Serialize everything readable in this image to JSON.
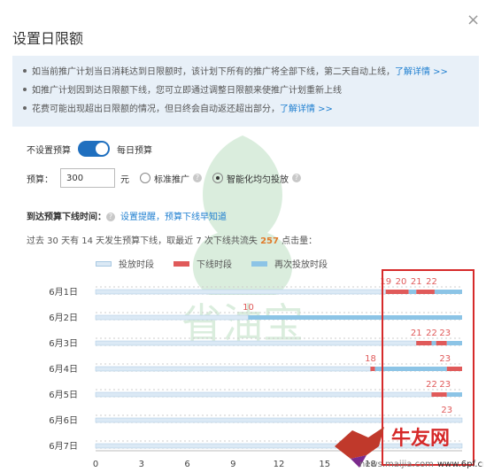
{
  "dialog": {
    "title": "设置日限额",
    "close_glyph": "×"
  },
  "tips": {
    "row1_text": "如当前推广计划当日消耗达到日限额时，该计划下所有的推广将全部下线，第二天自动上线，",
    "row1_link": "了解详情 >>",
    "row2_text": "如推广计划因到达日限额下线，您可立即通过调整日限额来使推广计划重新上线",
    "row3_text": "花费可能出现超出日限额的情况，但日终会自动返还超出部分，",
    "row3_link": "了解详情 >>"
  },
  "watermark": {
    "text": "省油宝"
  },
  "budget_toggle": {
    "left_label": "不设置预算",
    "right_label": "每日预算",
    "state": "on"
  },
  "budget": {
    "label": "预算：",
    "value": "300",
    "unit": "元",
    "option1": "标准推广",
    "option2": "智能化均匀投放",
    "selected": "智能化均匀投放"
  },
  "offline": {
    "label": "到达预算下线时间：",
    "link": "设置提醒，预算下线早知道"
  },
  "stats": {
    "prefix": "过去 30 天有 14 天发生预算下线，取最近 7 次下线共流失 ",
    "count": "257",
    "suffix": " 点击量："
  },
  "colors": {
    "serving": "#dbe9f5",
    "offline": "#e05a5a",
    "resumed": "#8cc4e6",
    "highlight_box": "#d62a2a",
    "link": "#1f7fd0"
  },
  "logo": {
    "brand": "牛友网",
    "url": "news.maijia.com",
    "url2": "www.6pf.cn"
  },
  "chart_data": {
    "type": "timeline",
    "legend": [
      "投放时段",
      "下线时段",
      "再次投放时段"
    ],
    "x_ticks": [
      "0",
      "3",
      "6",
      "9",
      "12",
      "15",
      "18"
    ],
    "xlim": [
      0,
      24
    ],
    "rows": [
      {
        "label": "6月1日",
        "marks": [
          "19",
          "20",
          "21",
          "22"
        ],
        "segments": [
          [
            0,
            19,
            "serving"
          ],
          [
            19,
            20.5,
            "offline"
          ],
          [
            20.5,
            21,
            "resumed"
          ],
          [
            21,
            22.2,
            "offline"
          ],
          [
            22.2,
            24,
            "resumed"
          ]
        ]
      },
      {
        "label": "6月2日",
        "marks": [
          "10"
        ],
        "segments": [
          [
            0,
            10,
            "serving"
          ],
          [
            10,
            24,
            "resumed"
          ]
        ]
      },
      {
        "label": "6月3日",
        "marks": [
          "21",
          "22",
          "23"
        ],
        "segments": [
          [
            0,
            21,
            "serving"
          ],
          [
            21,
            22,
            "offline"
          ],
          [
            22,
            22.3,
            "resumed"
          ],
          [
            22.3,
            23,
            "offline"
          ],
          [
            23,
            24,
            "resumed"
          ]
        ]
      },
      {
        "label": "6月4日",
        "marks": [
          "18",
          "23"
        ],
        "segments": [
          [
            0,
            18,
            "serving"
          ],
          [
            18,
            18.3,
            "offline"
          ],
          [
            18.3,
            23,
            "resumed"
          ],
          [
            23,
            24,
            "offline"
          ]
        ]
      },
      {
        "label": "6月5日",
        "marks": [
          "22",
          "23"
        ],
        "segments": [
          [
            0,
            22,
            "serving"
          ],
          [
            22,
            23,
            "offline"
          ],
          [
            23,
            24,
            "resumed"
          ]
        ]
      },
      {
        "label": "6月6日",
        "marks": [
          "23"
        ],
        "segments": [
          [
            0,
            24,
            "serving"
          ]
        ]
      },
      {
        "label": "6月7日",
        "marks": [],
        "segments": [
          [
            0,
            24,
            "serving"
          ]
        ]
      }
    ]
  }
}
